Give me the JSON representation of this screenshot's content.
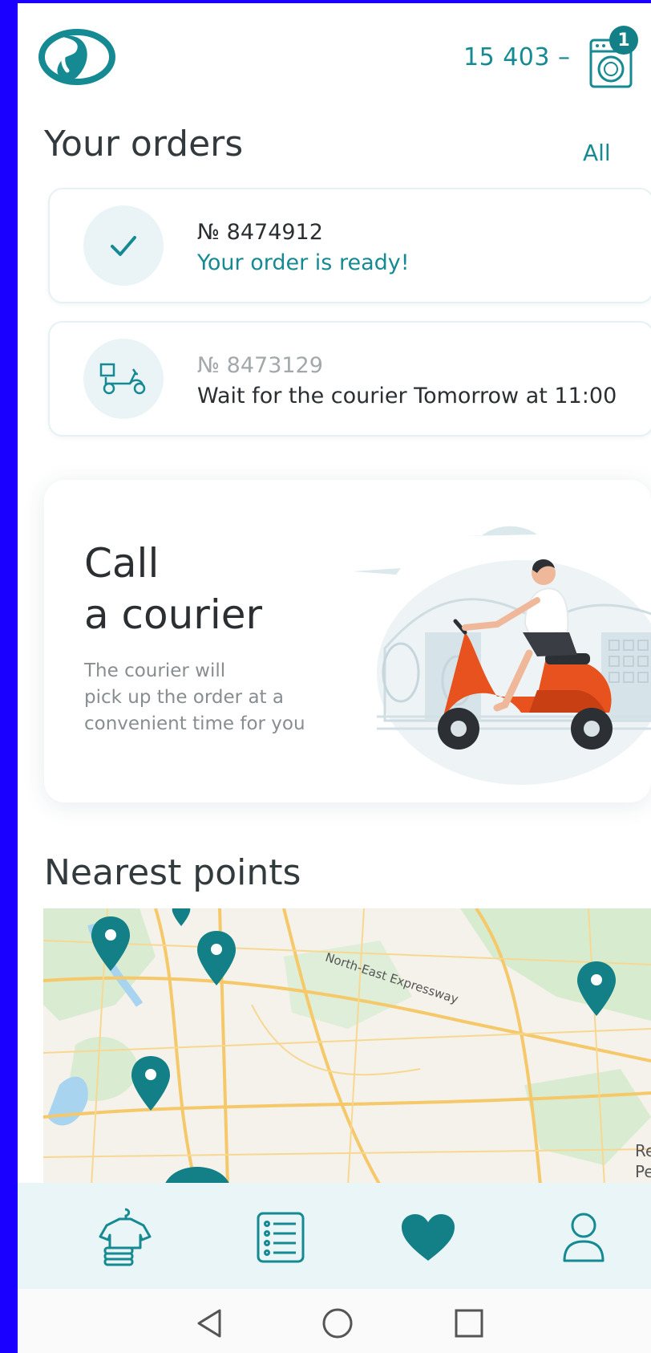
{
  "header": {
    "balance": "15 403 –",
    "cart_count": "1",
    "brand_color": "#158a92"
  },
  "orders": {
    "title": "Your orders",
    "all_label": "All",
    "items": [
      {
        "number": "№ 8474912",
        "status": "Your order is ready!",
        "icon": "check-icon"
      },
      {
        "number": "№ 8473129",
        "status": "Wait for the courier Tomorrow at 11:00",
        "icon": "scooter-icon"
      }
    ]
  },
  "promo": {
    "title_line1": "Call",
    "title_line2": "a courier",
    "text_line1": "The courier will",
    "text_line2": "pick up the order at a",
    "text_line3": "convenient time for you",
    "accent_color": "#e8521e"
  },
  "nearest": {
    "title": "Nearest points",
    "map_labels": {
      "road": "North-East Expressway",
      "edge1": "Re",
      "edge2": "Pe"
    }
  },
  "tabbar": {
    "items": [
      "laundry-icon",
      "list-icon",
      "heart-icon",
      "profile-icon"
    ],
    "active": "heart-icon"
  },
  "system_nav": [
    "back-icon",
    "home-icon",
    "recents-icon"
  ]
}
